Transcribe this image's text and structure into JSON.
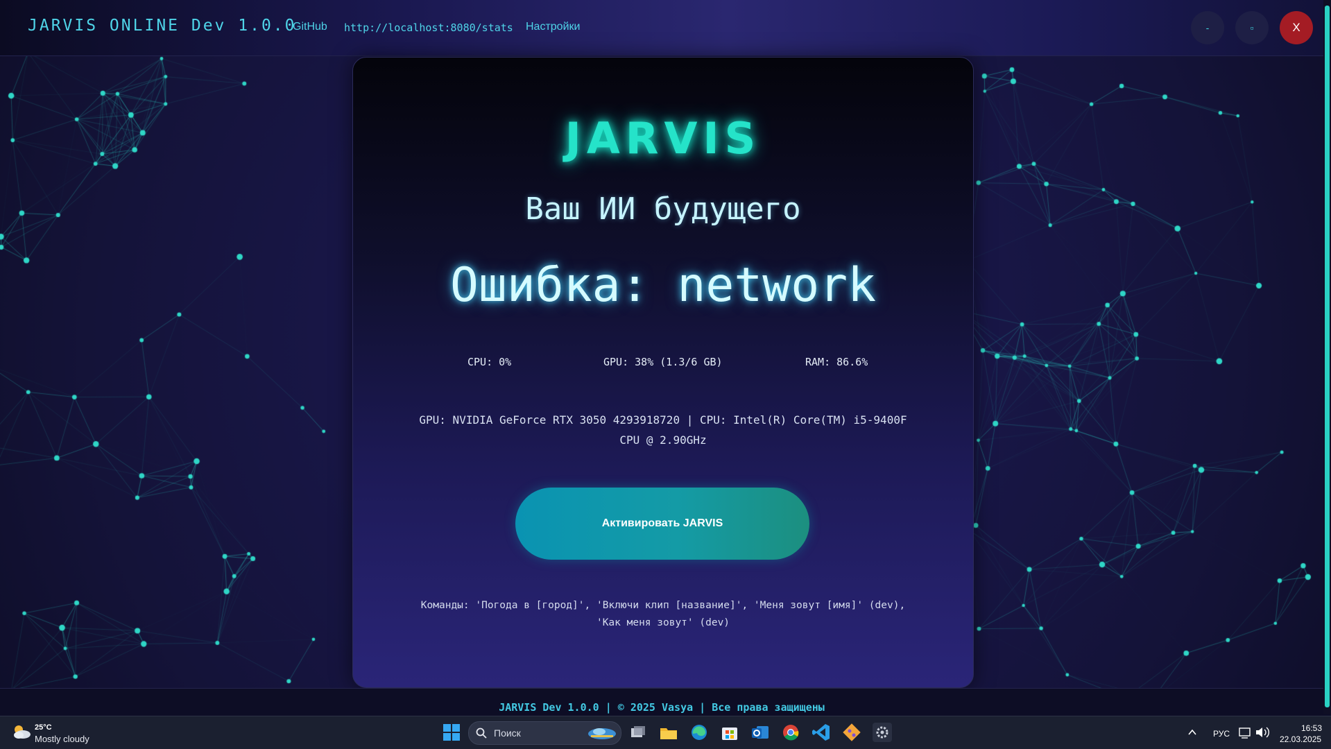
{
  "header": {
    "app_title": "JARVIS ONLINE Dev 1.0.0",
    "nav": {
      "github": "GitHub",
      "stats": "http://localhost:8080/stats",
      "settings": "Настройки"
    },
    "window_controls": {
      "minimize": "-",
      "maximize": "▫",
      "close": "X"
    }
  },
  "main": {
    "logo": "JARVIS",
    "subtitle": "Ваш ИИ будущего",
    "status": "Ошибка: network",
    "stats": {
      "cpu": "CPU: 0%",
      "gpu": "GPU: 38% (1.3/6 GB)",
      "ram": "RAM: 86.6%"
    },
    "hardware_line1": "GPU: NVIDIA GeForce RTX 3050 4293918720 | CPU: Intel(R) Core(TM) i5-9400F",
    "hardware_line2": "CPU @ 2.90GHz",
    "activate_label": "Активировать JARVIS",
    "commands_line1": "Команды: 'Погода в [город]', 'Включи клип [название]', 'Меня зовут [имя]' (dev),",
    "commands_line2": "'Как меня зовут' (dev)"
  },
  "footer": {
    "text": "JARVIS Dev 1.0.0 | © 2025 Vasya | Все права защищены"
  },
  "taskbar": {
    "weather": {
      "temp": "25°C",
      "desc": "Mostly cloudy",
      "icon": "cloud-sun-icon"
    },
    "search_placeholder": "Поиск",
    "apps": [
      "windows-start-icon",
      "task-view-icon",
      "file-explorer-icon",
      "edge-icon",
      "store-icon",
      "outlook-icon",
      "chrome-icon",
      "vscode-icon",
      "git-icon",
      "settings-app-icon"
    ],
    "language": "РУС",
    "time": "16:53",
    "date": "22.03.2025"
  },
  "colors": {
    "accent": "#25e3c9",
    "link": "#4fd4e8",
    "close": "#a41c24",
    "button_start": "#0a93b2",
    "button_end": "#1c8f7f"
  }
}
